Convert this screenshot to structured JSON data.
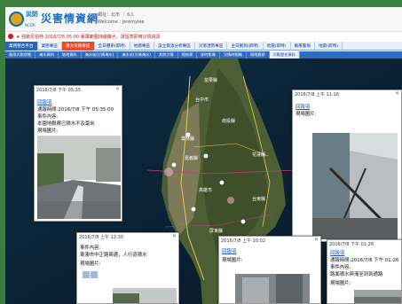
{
  "header": {
    "logo_abbr": "災防",
    "logo_sub": "NCDR",
    "site_title": "災害情資網",
    "user_info": "網址：北市 ｜ 6人",
    "welcome": "Welcome : jeremylee"
  },
  "alert": {
    "text": "★ 強颱尼伯特 2016/7/8 05:00 暴風範圍持續擴大，請留意即時災情資訊"
  },
  "nav_primary": [
    {
      "label": "業務整合平台",
      "state": "active"
    },
    {
      "label": "業務專區",
      "state": ""
    },
    {
      "label": "重大災情專區",
      "state": "hot"
    },
    {
      "label": "全日體系(即時)",
      "state": ""
    },
    {
      "label": "地圖專區",
      "state": ""
    },
    {
      "label": "設立資源分析專區",
      "state": ""
    },
    {
      "label": "災害潛勢專區",
      "state": ""
    },
    {
      "label": "主日觀測(即時)",
      "state": ""
    },
    {
      "label": "地震(即時)",
      "state": ""
    },
    {
      "label": "颱風警報",
      "state": ""
    },
    {
      "label": "地震(即時)",
      "state": ""
    }
  ],
  "nav_secondary": [
    {
      "label": "風雨災點狀態",
      "state": ""
    },
    {
      "label": "淹水資料",
      "state": ""
    },
    {
      "label": "坡地資料",
      "state": ""
    },
    {
      "label": "淹水站(災情淹水)",
      "state": ""
    },
    {
      "label": "淹水站(災情淹水)",
      "state": ""
    },
    {
      "label": "其他災情",
      "state": ""
    },
    {
      "label": "總結果",
      "state": ""
    },
    {
      "label": "即時影像",
      "state": ""
    },
    {
      "label": "災情時間軸",
      "state": ""
    },
    {
      "label": "現地觀察",
      "state": ""
    },
    {
      "label": "災點歷史資料",
      "state": "light"
    }
  ],
  "popups": [
    {
      "id": "left",
      "title": "2016/7/8 下午 05:35",
      "lines": [
        {
          "text": "回報項",
          "kind": "link"
        },
        {
          "text": "通報時間:2016/7/8 下午 05:35:00",
          "kind": "text"
        },
        {
          "text": "事件內容:",
          "kind": "text"
        },
        {
          "text": "本園地觀察已積水不及毫米",
          "kind": "text"
        },
        {
          "text": "現場圖片:",
          "kind": "text"
        }
      ]
    },
    {
      "id": "right",
      "title": "2016/7/8 上午 11:16",
      "lines": [
        {
          "text": "回報項",
          "kind": "link"
        },
        {
          "text": "現場圖片:",
          "kind": "text"
        }
      ]
    },
    {
      "id": "bottom-left",
      "title": "2016/7/8 上午 12:30",
      "lines": [
        {
          "text": "事件內容:",
          "kind": "text"
        },
        {
          "text": "東澳市中正路兩邊，人行道積水",
          "kind": "text"
        },
        {
          "text": "現場圖片:",
          "kind": "text"
        }
      ]
    },
    {
      "id": "bottom-center",
      "title": "2016/7/8 上午 10:02",
      "lines": [
        {
          "text": "回報項",
          "kind": "link"
        },
        {
          "text": "現場圖片:",
          "kind": "text"
        }
      ]
    },
    {
      "id": "bottom-right",
      "title": "2016/7/8 下午 01:26",
      "lines": [
        {
          "text": "回報項",
          "kind": "link"
        },
        {
          "text": "通報時間:2016/7/8 下午 01:26",
          "kind": "text"
        },
        {
          "text": "事件內容:",
          "kind": "text"
        },
        {
          "text": "路面積水與淹至到到通路",
          "kind": "text"
        },
        {
          "text": "現場圖片:",
          "kind": "text"
        }
      ]
    }
  ],
  "map_labels": [
    "苗栗縣",
    "台中市",
    "南投縣",
    "雲林縣",
    "嘉義縣",
    "高雄市",
    "台東縣",
    "屏東縣",
    "花蓮縣"
  ],
  "colors": {
    "site_blue": "#1c6fc2",
    "alert_red": "#c01a1a",
    "nav_blue": "#2f6cc0",
    "nav_hot": "#e84c2b",
    "frame_green": "#3b7f3c"
  }
}
